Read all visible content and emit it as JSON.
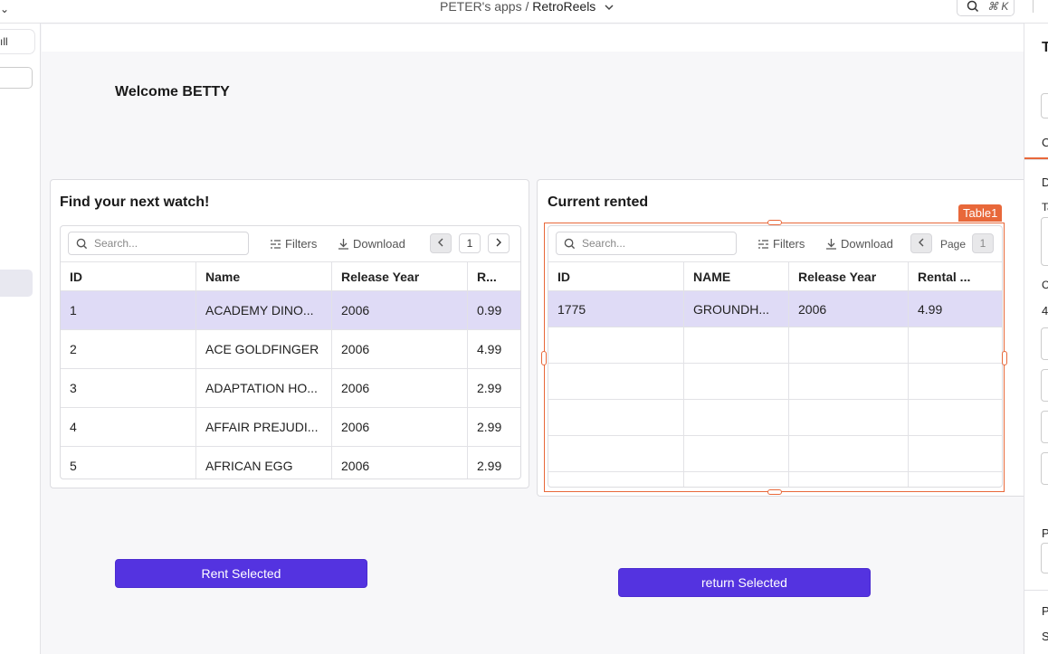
{
  "topbar": {
    "workspace": "PETER's apps /",
    "app_name": "RetroReels",
    "shortcut": "⌘ K"
  },
  "leftpanel": {
    "tab_label": "ıll"
  },
  "welcome": "Welcome BETTY",
  "left_table": {
    "title": "Find your next watch!",
    "search_placeholder": "Search...",
    "filters": "Filters",
    "download": "Download",
    "page": "1",
    "columns": [
      "ID",
      "Name",
      "Release Year",
      "R..."
    ],
    "rows": [
      [
        "1",
        "ACADEMY DINO...",
        "2006",
        "0.99"
      ],
      [
        "2",
        "ACE GOLDFINGER",
        "2006",
        "4.99"
      ],
      [
        "3",
        "ADAPTATION HO...",
        "2006",
        "2.99"
      ],
      [
        "4",
        "AFFAIR PREJUDI...",
        "2006",
        "2.99"
      ],
      [
        "5",
        "AFRICAN EGG",
        "2006",
        "2.99"
      ]
    ]
  },
  "right_table": {
    "title": "Current rented",
    "tag": "Table1",
    "search_placeholder": "Search...",
    "filters": "Filters",
    "download": "Download",
    "page_label": "Page",
    "page": "1",
    "columns": [
      "ID",
      "NAME",
      "Release Year",
      "Rental ..."
    ],
    "rows": [
      [
        "1775",
        "GROUNDH...",
        "2006",
        "4.99"
      ]
    ]
  },
  "buttons": {
    "rent": "Rent Selected",
    "return": "return Selected"
  },
  "rightpanel": {
    "letters": [
      "T",
      "C",
      "D",
      "Ta",
      "C",
      "4",
      "P",
      "P",
      "S"
    ]
  },
  "colors": {
    "accent": "#5433e0",
    "selection": "#e8683a",
    "row_selected": "#dfdbf6"
  }
}
